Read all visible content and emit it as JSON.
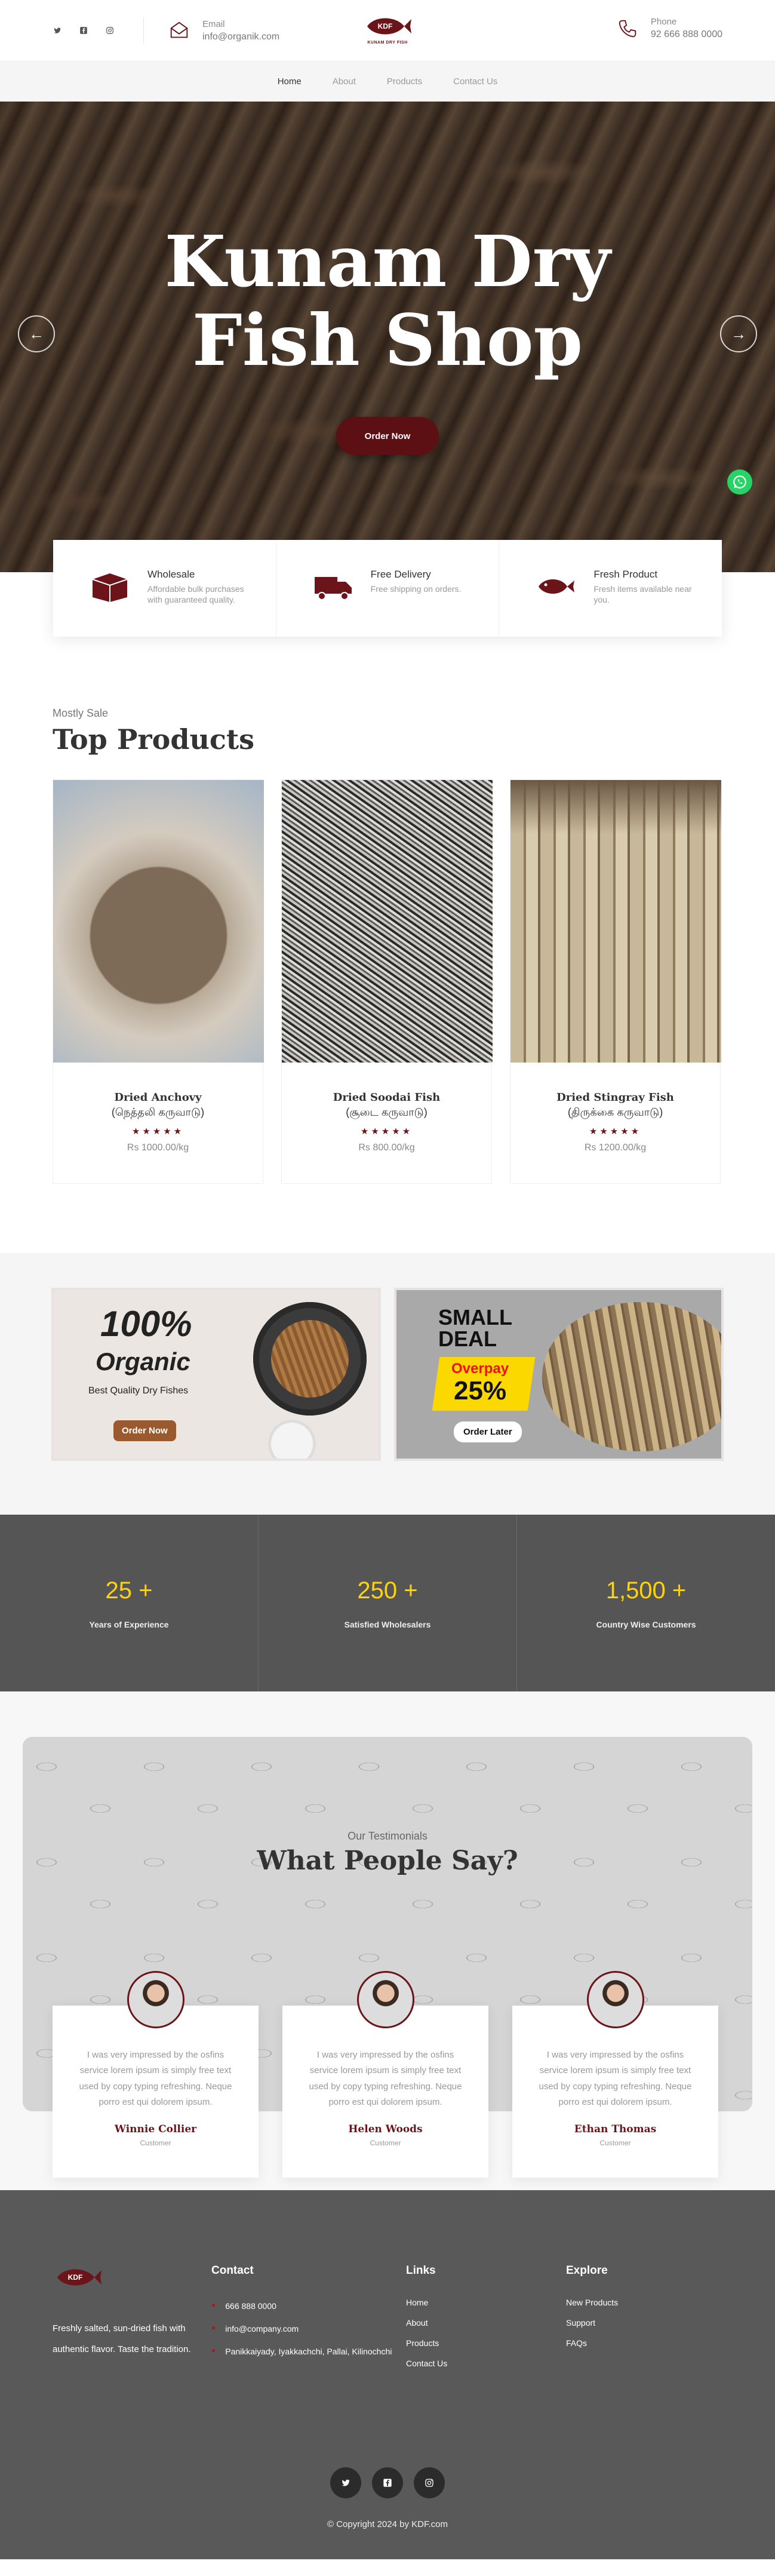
{
  "header": {
    "email_label": "Email",
    "email_value": "info@organik.com",
    "phone_label": "Phone",
    "phone_value": "92 666 888 0000",
    "logo_text": "KDF",
    "logo_sub": "KUNAM DRY FISH"
  },
  "nav": {
    "items": [
      "Home",
      "About",
      "Products",
      "Contact Us"
    ]
  },
  "hero": {
    "title": "Kunam Dry Fish Shop",
    "button": "Order Now"
  },
  "features": [
    {
      "title": "Wholesale",
      "desc": "Affordable bulk purchases with guaranteed quality."
    },
    {
      "title": "Free Delivery",
      "desc": "Free shipping on orders."
    },
    {
      "title": "Fresh Product",
      "desc": "Fresh items available near you."
    }
  ],
  "products": {
    "eyebrow": "Mostly Sale",
    "title": "Top Products",
    "items": [
      {
        "name": "Dried Anchovy",
        "tamil": "(நெத்தலி கருவாடு)",
        "stars": "★★★★★",
        "price": "Rs 1000.00/kg"
      },
      {
        "name": "Dried Soodai Fish",
        "tamil": "(சூடை கருவாடு)",
        "stars": "★★★★★",
        "price": "Rs 800.00/kg"
      },
      {
        "name": "Dried Stingray Fish",
        "tamil": "(திருக்கை கருவாடு)",
        "stars": "★★★★★",
        "price": "Rs 1200.00/kg"
      }
    ]
  },
  "promo": {
    "b1": {
      "big": "100%",
      "org": "Organic",
      "sub": "Best Quality Dry Fishes",
      "button": "Order Now"
    },
    "b2": {
      "small": "SMALL",
      "deal": "DEAL",
      "over": "Overpay",
      "pct": "25%",
      "button": "Order Later"
    }
  },
  "stats": [
    {
      "num": "25 +",
      "label": "Years of Experience"
    },
    {
      "num": "250 +",
      "label": "Satisfied Wholesalers"
    },
    {
      "num": "1,500 +",
      "label": "Country Wise Customers"
    }
  ],
  "testimonials": {
    "eyebrow": "Our Testimonials",
    "title": "What People Say?",
    "items": [
      {
        "quote": "I was very impressed by the osfins service lorem ipsum is simply free text used by copy typing refreshing. Neque porro est qui dolorem ipsum.",
        "name": "Winnie Collier",
        "role": "Customer"
      },
      {
        "quote": "I was very impressed by the osfins service lorem ipsum is simply free text used by copy typing refreshing. Neque porro est qui dolorem ipsum.",
        "name": "Helen Woods",
        "role": "Customer"
      },
      {
        "quote": "I was very impressed by the osfins service lorem ipsum is simply free text used by copy typing refreshing. Neque porro est qui dolorem ipsum.",
        "name": "Ethan Thomas",
        "role": "Customer"
      }
    ]
  },
  "footer": {
    "logo_text": "KDF",
    "about": "Freshly salted, sun-dried fish with authentic flavor. Taste the tradition.",
    "contact_title": "Contact",
    "contact": [
      "666 888 0000",
      "info@company.com",
      "Panikkaiyady, Iyakkachchi, Pallai, Kilinochchi"
    ],
    "links_title": "Links",
    "links": [
      "Home",
      "About",
      "Products",
      "Contact Us"
    ],
    "explore_title": "Explore",
    "explore": [
      "New Products",
      "Support",
      "FAQs"
    ],
    "copyright": "© Copyright 2024 by KDF.com"
  },
  "colors": {
    "brand": "#6b1419",
    "accent": "#ffd400",
    "stats_bg": "#555555",
    "footer_bg": "#595959"
  }
}
